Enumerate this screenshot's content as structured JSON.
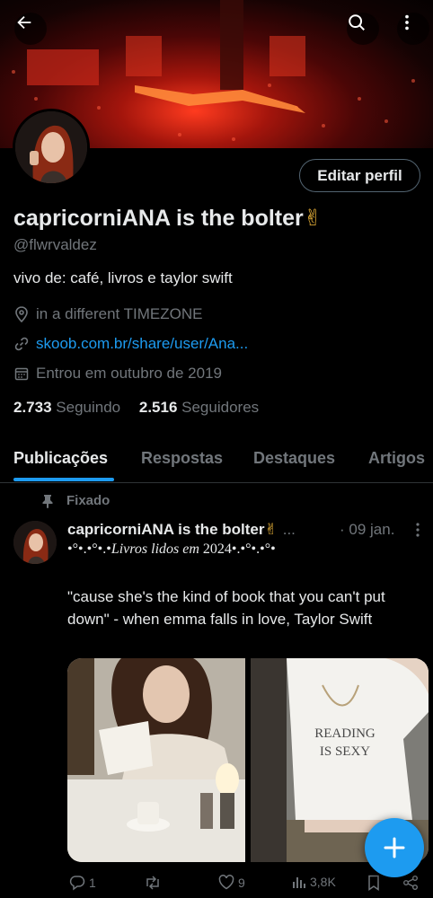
{
  "header": {
    "back_icon": "arrow-left-icon",
    "search_icon": "search-icon",
    "more_icon": "more-vertical-icon"
  },
  "profile": {
    "edit_button": "Editar perfil",
    "display_name": "capricorniANA is the bolter",
    "name_emoji": "✌",
    "handle": "@flwrvaldez",
    "bio": "vivo de: café, livros e taylor swift",
    "location": "in a different TIMEZONE",
    "website": "skoob.com.br/share/user/Ana...",
    "joined": "Entrou em outubro de 2019",
    "following_count": "2.733",
    "following_label": "Seguindo",
    "followers_count": "2.516",
    "followers_label": "Seguidores"
  },
  "tabs": [
    {
      "label": "Publicações",
      "active": true
    },
    {
      "label": "Respostas",
      "active": false
    },
    {
      "label": "Destaques",
      "active": false
    },
    {
      "label": "Artigos",
      "active": false
    }
  ],
  "post": {
    "pinned_label": "Fixado",
    "author": "capricorniANA is the bolter",
    "author_emoji": "✌",
    "ellipsis": "...",
    "date": "· 09 jan.",
    "line1_prefix": "•°•.•°•.•",
    "line1_italic": "Livros lidos em",
    "line1_suffix": "2024•.•°•.•°•",
    "text": "\"cause she's the kind of book that you can't put down\" - when emma falls in love, Taylor Swift",
    "image_text_line1": "READING",
    "image_text_line2": "IS SEXY",
    "replies": "1",
    "reposts": "",
    "likes": "9",
    "views": "3,8K"
  },
  "colors": {
    "accent": "#1d9bf0",
    "background": "#000000",
    "text_primary": "#e7e9ea",
    "text_secondary": "#71767b"
  }
}
